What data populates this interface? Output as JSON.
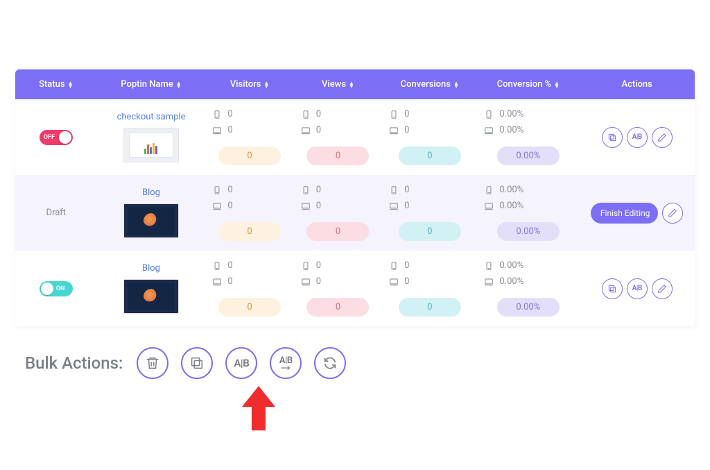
{
  "header": {
    "status": "Status",
    "name": "Poptin Name",
    "visitors": "Visitors",
    "views": "Views",
    "conversions": "Conversions",
    "convpct": "Conversion %",
    "actions": "Actions"
  },
  "rows": [
    {
      "status_type": "toggle",
      "status_on": false,
      "status_label": "OFF",
      "name": "checkout sample",
      "thumb": "light",
      "visitors_mobile": "0",
      "visitors_desktop": "0",
      "visitors_total": "0",
      "views_mobile": "0",
      "views_desktop": "0",
      "views_total": "0",
      "conversions_mobile": "0",
      "conversions_desktop": "0",
      "conversions_total": "0",
      "convpct_mobile": "0.00%",
      "convpct_desktop": "0.00%",
      "convpct_total": "0.00%",
      "action_variant": "icons"
    },
    {
      "status_type": "text",
      "status_label": "Draft",
      "name": "Blog",
      "thumb": "dark",
      "visitors_mobile": "0",
      "visitors_desktop": "0",
      "visitors_total": "0",
      "views_mobile": "0",
      "views_desktop": "0",
      "views_total": "0",
      "conversions_mobile": "0",
      "conversions_desktop": "0",
      "conversions_total": "0",
      "convpct_mobile": "0.00%",
      "convpct_desktop": "0.00%",
      "convpct_total": "0.00%",
      "action_variant": "finish"
    },
    {
      "status_type": "toggle",
      "status_on": true,
      "status_label": "ON",
      "name": "Blog",
      "thumb": "dark",
      "visitors_mobile": "0",
      "visitors_desktop": "0",
      "visitors_total": "0",
      "views_mobile": "0",
      "views_desktop": "0",
      "views_total": "0",
      "conversions_mobile": "0",
      "conversions_desktop": "0",
      "conversions_total": "0",
      "convpct_mobile": "0.00%",
      "convpct_desktop": "0.00%",
      "convpct_total": "0.00%",
      "action_variant": "icons"
    }
  ],
  "actions": {
    "finish_label": "Finish Editing"
  },
  "bulk": {
    "title": "Bulk Actions:"
  }
}
